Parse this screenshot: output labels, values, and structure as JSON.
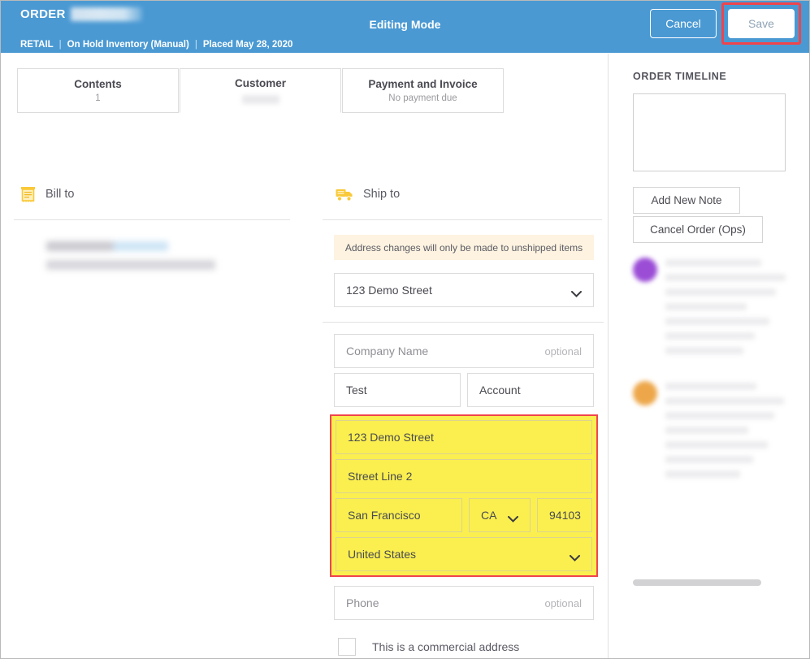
{
  "header": {
    "order_label": "ORDER",
    "order_number_redacted": true,
    "title": "Editing Mode",
    "meta": {
      "channel": "RETAIL",
      "status": "On Hold Inventory (Manual)",
      "placed": "Placed May 28, 2020",
      "separator": "|"
    },
    "cancel_label": "Cancel",
    "save_label": "Save",
    "background_color": "#4a99d3",
    "annotation_color": "#f0444c"
  },
  "tabs": [
    {
      "label": "Contents",
      "sub": "1",
      "active": false,
      "redacted_sub": false
    },
    {
      "label": "Customer",
      "sub": "",
      "active": true,
      "redacted_sub": true
    },
    {
      "label": "Payment and Invoice",
      "sub": "No payment due",
      "active": false,
      "redacted_sub": false
    }
  ],
  "bill_to": {
    "icon": "receipt-icon",
    "title": "Bill to",
    "redacted": true
  },
  "ship_to": {
    "icon": "truck-icon",
    "title": "Ship to",
    "notice": "Address changes will only be made to unshipped items",
    "saved_address": {
      "value": "123 Demo Street",
      "icon": "chevron-down-icon"
    },
    "fields": {
      "company": {
        "placeholder": "Company Name",
        "value": "",
        "optional_label": "optional"
      },
      "first_name": {
        "value": "Test"
      },
      "last_name": {
        "value": "Account"
      },
      "street1": {
        "value": "123 Demo Street"
      },
      "street2": {
        "value": "Street Line 2"
      },
      "city": {
        "value": "San Francisco"
      },
      "state": {
        "value": "CA"
      },
      "zip": {
        "value": "94103"
      },
      "country": {
        "value": "United States"
      },
      "phone": {
        "placeholder": "Phone",
        "value": "",
        "optional_label": "optional"
      }
    },
    "highlight_color": "#faef4f",
    "commercial_checkbox": {
      "label": "This is a commercial address",
      "checked": false
    }
  },
  "sidebar": {
    "title": "ORDER TIMELINE",
    "note_placeholder": "",
    "note_value": "",
    "add_note_label": "Add New Note",
    "cancel_order_label": "Cancel Order (Ops)",
    "timeline_entries": [
      {
        "avatar_color": "#9b4dd6",
        "redacted": true
      },
      {
        "avatar_color": "#eda74a",
        "redacted": true
      }
    ]
  }
}
